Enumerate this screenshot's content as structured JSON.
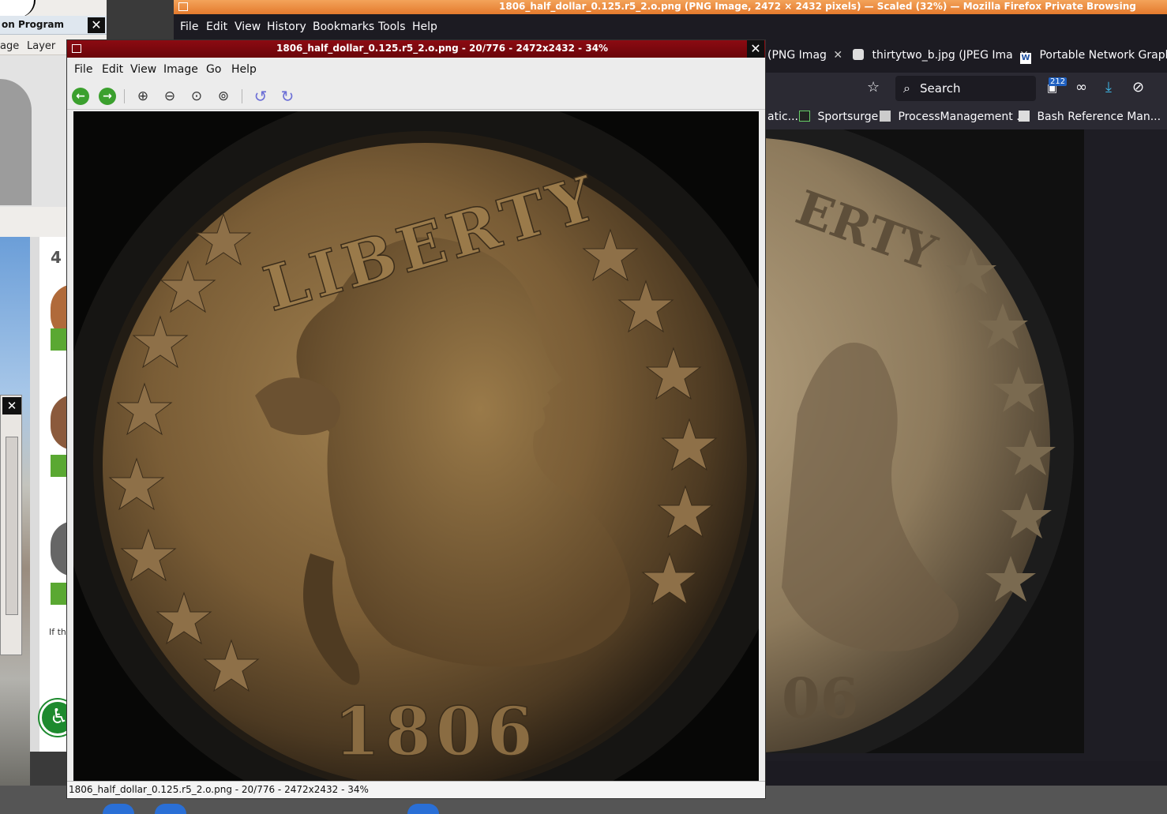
{
  "left_app": {
    "title": "on Program",
    "menu": [
      "age",
      "Layer"
    ],
    "close_glyph": "✕"
  },
  "left_dialog": {
    "close_glyph": "✕"
  },
  "web_panel": {
    "number": "4",
    "text": "If th"
  },
  "firefox": {
    "title": "1806_half_dollar_0.125.r5_2.o.png (PNG Image, 2472 × 2432 pixels) — Scaled (32%) — Mozilla Firefox Private Browsing",
    "menu": [
      "File",
      "Edit",
      "View",
      "History",
      "Bookmarks",
      "Tools",
      "Help"
    ],
    "tabs": [
      {
        "label": "(PNG Imag",
        "close": "✕"
      },
      {
        "label": "thirtytwo_b.jpg (JPEG Ima",
        "close": "✕"
      },
      {
        "label": "Portable Network Graphi",
        "close": ""
      }
    ],
    "search_placeholder": "Search",
    "badge": "212",
    "bookmarks": [
      "atic...",
      "Sportsurge",
      "ProcessManagement ...",
      "Bash Reference Man..."
    ],
    "coin_text": {
      "arc": "ERTY",
      "date": "06"
    }
  },
  "viewer": {
    "title": "1806_half_dollar_0.125.r5_2.o.png - 20/776 - 2472x2432 - 34%",
    "menu": [
      "File",
      "Edit",
      "View",
      "Image",
      "Go",
      "Help"
    ],
    "close_glyph": "✕",
    "coin_text": {
      "arc": "LIBERTY",
      "date": "1806"
    },
    "status": "1806_half_dollar_0.125.r5_2.o.png - 20/776 - 2472x2432 - 34%"
  },
  "colors": {
    "firefox_chrome": "#1c1b22",
    "firefox_title": "#e47a2d",
    "viewer_title": "#7a0810",
    "coin_bronze": "#8a6a3d"
  }
}
